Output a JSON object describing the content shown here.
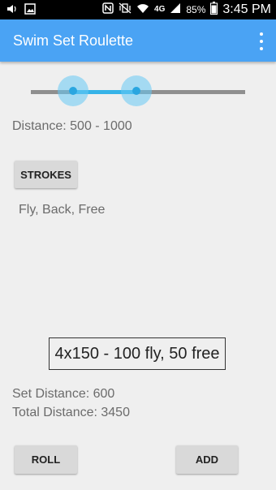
{
  "status_bar": {
    "icons": [
      "volume-icon",
      "gallery-icon",
      "nfc-icon",
      "vibrate-off-icon",
      "wifi-icon",
      "lte-icon",
      "signal-icon",
      "battery-icon"
    ],
    "network": "4G",
    "battery": "85%",
    "time": "3:45 PM"
  },
  "app_bar": {
    "title": "Swim Set Roulette",
    "accent": "#4aa3f4"
  },
  "distance_slider": {
    "min_value": 500,
    "max_value": 1000,
    "label": "Distance: 500 - 1000",
    "active_color": "#36b3e8",
    "track_color": "#8f8f8f"
  },
  "strokes": {
    "button_label": "STROKES",
    "selected": "Fly, Back, Free"
  },
  "result": {
    "set": "4x150 - 100 fly, 50 free",
    "set_distance": "Set Distance: 600",
    "total_distance": "Total Distance: 3450"
  },
  "actions": {
    "roll_label": "ROLL",
    "add_label": "ADD"
  }
}
